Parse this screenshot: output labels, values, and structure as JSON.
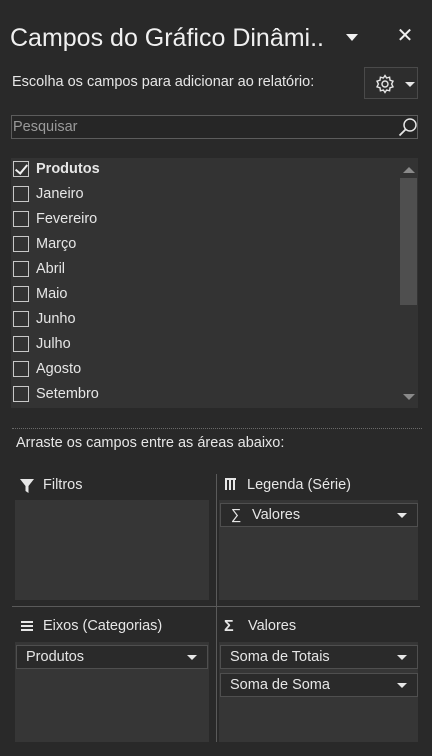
{
  "panel": {
    "title": "Campos do Gráfico Dinâmi..",
    "close_glyph": "✕"
  },
  "instruction": "Escolha os campos para adicionar ao relatório:",
  "search": {
    "placeholder": "Pesquisar",
    "value": ""
  },
  "fields": [
    {
      "label": "Produtos",
      "checked": true
    },
    {
      "label": "Janeiro",
      "checked": false
    },
    {
      "label": "Fevereiro",
      "checked": false
    },
    {
      "label": "Março",
      "checked": false
    },
    {
      "label": "Abril",
      "checked": false
    },
    {
      "label": "Maio",
      "checked": false
    },
    {
      "label": "Junho",
      "checked": false
    },
    {
      "label": "Julho",
      "checked": false
    },
    {
      "label": "Agosto",
      "checked": false
    },
    {
      "label": "Setembro",
      "checked": false
    }
  ],
  "drag_instruction": "Arraste os campos entre as áreas abaixo:",
  "areas": {
    "filters": {
      "label": "Filtros",
      "items": []
    },
    "legend": {
      "label": "Legenda (Série)",
      "items": [
        {
          "label": "Valores",
          "sigma": "∑"
        }
      ]
    },
    "axes": {
      "label": "Eixos (Categorias)",
      "items": [
        {
          "label": "Produtos"
        }
      ]
    },
    "values": {
      "label": "Valores",
      "sigma": "Σ",
      "items": [
        {
          "label": "Soma de Totais"
        },
        {
          "label": "Soma de Soma"
        }
      ]
    }
  },
  "icons": {
    "gear": "gear-icon",
    "search": "search-icon",
    "filter": "filter-icon",
    "legend": "columns-icon",
    "axes": "rows-icon",
    "values": "sigma-icon"
  },
  "colors": {
    "background": "#292929",
    "list_background": "#333333",
    "text": "#e6e6e6"
  }
}
